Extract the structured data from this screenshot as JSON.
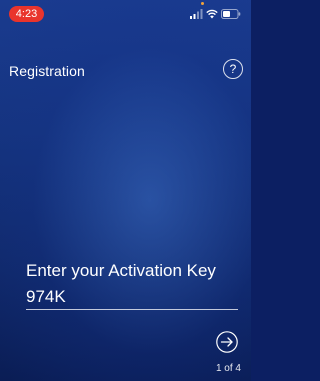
{
  "status_bar": {
    "time": "4:23",
    "icons": [
      "signal-icon",
      "wifi-icon",
      "battery-icon"
    ]
  },
  "nav": {
    "title": "Registration",
    "help_label": "?"
  },
  "form": {
    "prompt": "Enter your Activation Key",
    "value": "974K"
  },
  "footer": {
    "next_icon": "arrow-right-circle-icon",
    "page_indicator": "1 of 4"
  },
  "colors": {
    "time_pill": "#e9342c",
    "background_top": "#1a3b8f",
    "background_bottom": "#0a1d55",
    "text": "#ffffff"
  }
}
